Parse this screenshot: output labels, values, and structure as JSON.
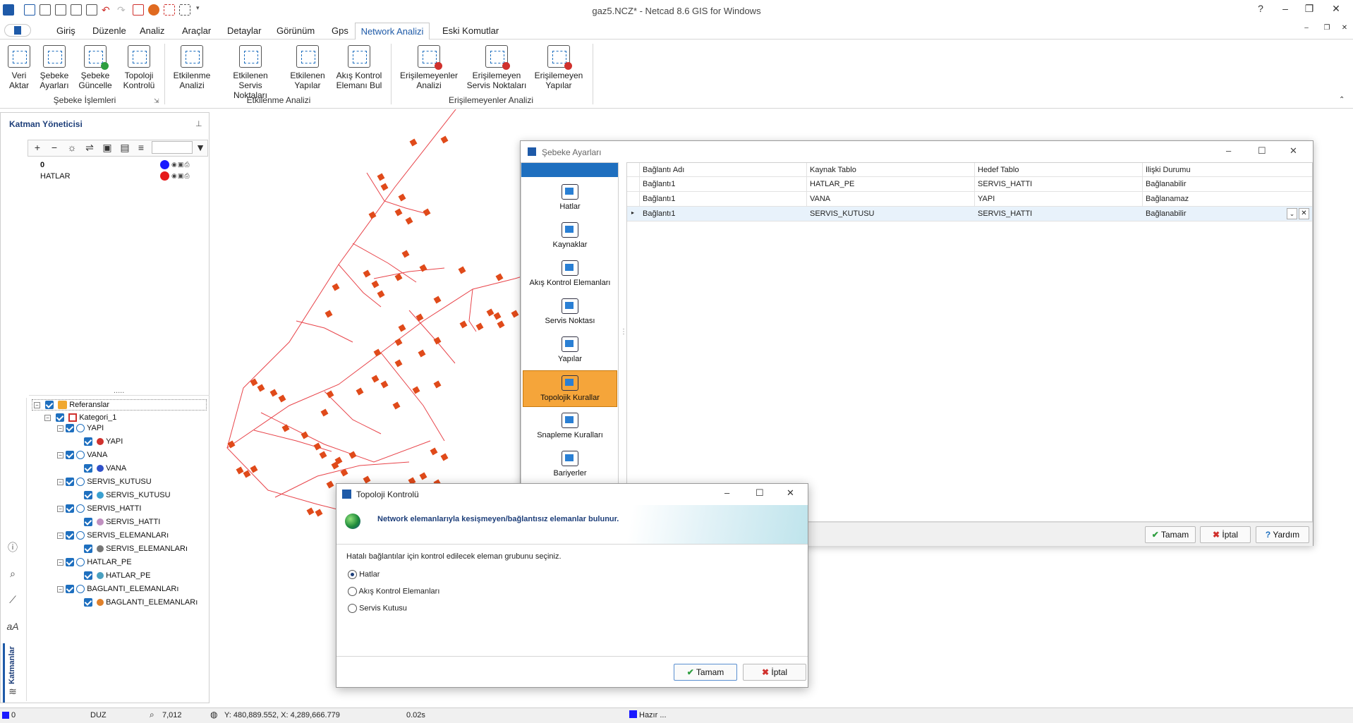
{
  "window": {
    "title": "gaz5.NCZ* - Netcad 8.6 GIS for Windows",
    "help_label": "?"
  },
  "menu": {
    "tabs": [
      "Giriş",
      "Düzenle",
      "Analiz",
      "Araçlar",
      "Detaylar",
      "Görünüm",
      "Gps"
    ],
    "active_tab": "Network Analizi",
    "extra_tab": "Eski Komutlar"
  },
  "ribbon": {
    "buttons": [
      {
        "line1": "Veri",
        "line2": "Aktar"
      },
      {
        "line1": "Şebeke",
        "line2": "Ayarları"
      },
      {
        "line1": "Şebeke",
        "line2": "Güncelle"
      },
      {
        "line1": "Topoloji",
        "line2": "Kontrolü"
      },
      {
        "line1": "Etkilenme",
        "line2": "Analizi"
      },
      {
        "line1": "Etkilenen Servis",
        "line2": "Noktaları"
      },
      {
        "line1": "Etkilenen",
        "line2": "Yapılar"
      },
      {
        "line1": "Akış Kontrol",
        "line2": "Elemanı Bul"
      },
      {
        "line1": "Erişilemeyenler",
        "line2": "Analizi"
      },
      {
        "line1": "Erişilemeyen",
        "line2": "Servis Noktaları"
      },
      {
        "line1": "Erişilemeyen",
        "line2": "Yapılar"
      }
    ],
    "groups": [
      "Şebeke İşlemleri",
      "Etkilenme Analizi",
      "Erişilemeyenler Analizi"
    ]
  },
  "layer_manager": {
    "title": "Katman Yöneticisi",
    "layers": [
      {
        "name": "0",
        "color": "#1a1aff"
      },
      {
        "name": "HATLAR",
        "color": "#e61919"
      }
    ],
    "splitter": ".....",
    "tree": {
      "root": "Referanslar",
      "category": "Kategori_1",
      "items": [
        {
          "group": "YAPI",
          "layer": "YAPI",
          "color": "#d0312d"
        },
        {
          "group": "VANA",
          "layer": "VANA",
          "color": "#3050c8"
        },
        {
          "group": "SERVIS_KUTUSU",
          "layer": "SERVIS_KUTUSU",
          "color": "#3aa0d0"
        },
        {
          "group": "SERVIS_HATTI",
          "layer": "SERVIS_HATTI",
          "color": "#c090c0"
        },
        {
          "group": "SERVIS_ELEMANLARı",
          "layer": "SERVIS_ELEMANLARı",
          "color": "#777777"
        },
        {
          "group": "HATLAR_PE",
          "layer": "HATLAR_PE",
          "color": "#4aa0c0"
        },
        {
          "group": "BAGLANTI_ELEMANLARı",
          "layer": "BAGLANTI_ELEMANLARı",
          "color": "#e0802a"
        }
      ]
    },
    "side_tab": "Katmanlar"
  },
  "sebeke_dialog": {
    "title": "Şebeke Ayarları",
    "nav": [
      {
        "label": "Hatlar",
        "active": false
      },
      {
        "label": "Kaynaklar",
        "active": false
      },
      {
        "label": "Akış Kontrol Elemanları",
        "active": false
      },
      {
        "label": "Servis Noktası",
        "active": false
      },
      {
        "label": "Yapılar",
        "active": false
      },
      {
        "label": "Topolojik Kurallar",
        "active": true
      },
      {
        "label": "Snapleme Kuralları",
        "active": false
      },
      {
        "label": "Bariyerler",
        "active": false
      }
    ],
    "columns": [
      "Bağlantı Adı",
      "Kaynak Tablo",
      "Hedef Tablo",
      "İlişki Durumu"
    ],
    "rows": [
      [
        "Bağlantı1",
        "HATLAR_PE",
        "SERVIS_HATTI",
        "Bağlanabilir"
      ],
      [
        "Bağlantı1",
        "VANA",
        "YAPI",
        "Bağlanamaz"
      ],
      [
        "Bağlantı1",
        "SERVIS_KUTUSU",
        "SERVIS_HATTI",
        "Bağlanabilir"
      ]
    ],
    "ok_label": "Tamam",
    "cancel_label": "İptal",
    "help_label": "Yardım"
  },
  "topology_dialog": {
    "title": "Topoloji Kontrolü",
    "header": "Network elemanlarıyla kesişmeyen/bağlantısız elemanlar bulunur.",
    "prompt": "Hatalı bağlantılar için kontrol edilecek eleman grubunu seçiniz.",
    "options": [
      {
        "label": "Hatlar",
        "selected": true
      },
      {
        "label": "Akış Kontrol Elemanları",
        "selected": false
      },
      {
        "label": "Servis Kutusu",
        "selected": false
      }
    ],
    "ok_label": "Tamam",
    "cancel_label": "İptal"
  },
  "status": {
    "layer_index": "0",
    "mode": "DUZ",
    "zoom": "7,012",
    "coords": "Y: 480,889.552, X: 4,289,666.779",
    "time": "0.02s",
    "state": "Hazır ..."
  },
  "colors": {
    "accent": "#1e5aa8",
    "map_line": "#e8444a",
    "map_building": "#e04a1a",
    "active_nav": "#f5a53a"
  }
}
